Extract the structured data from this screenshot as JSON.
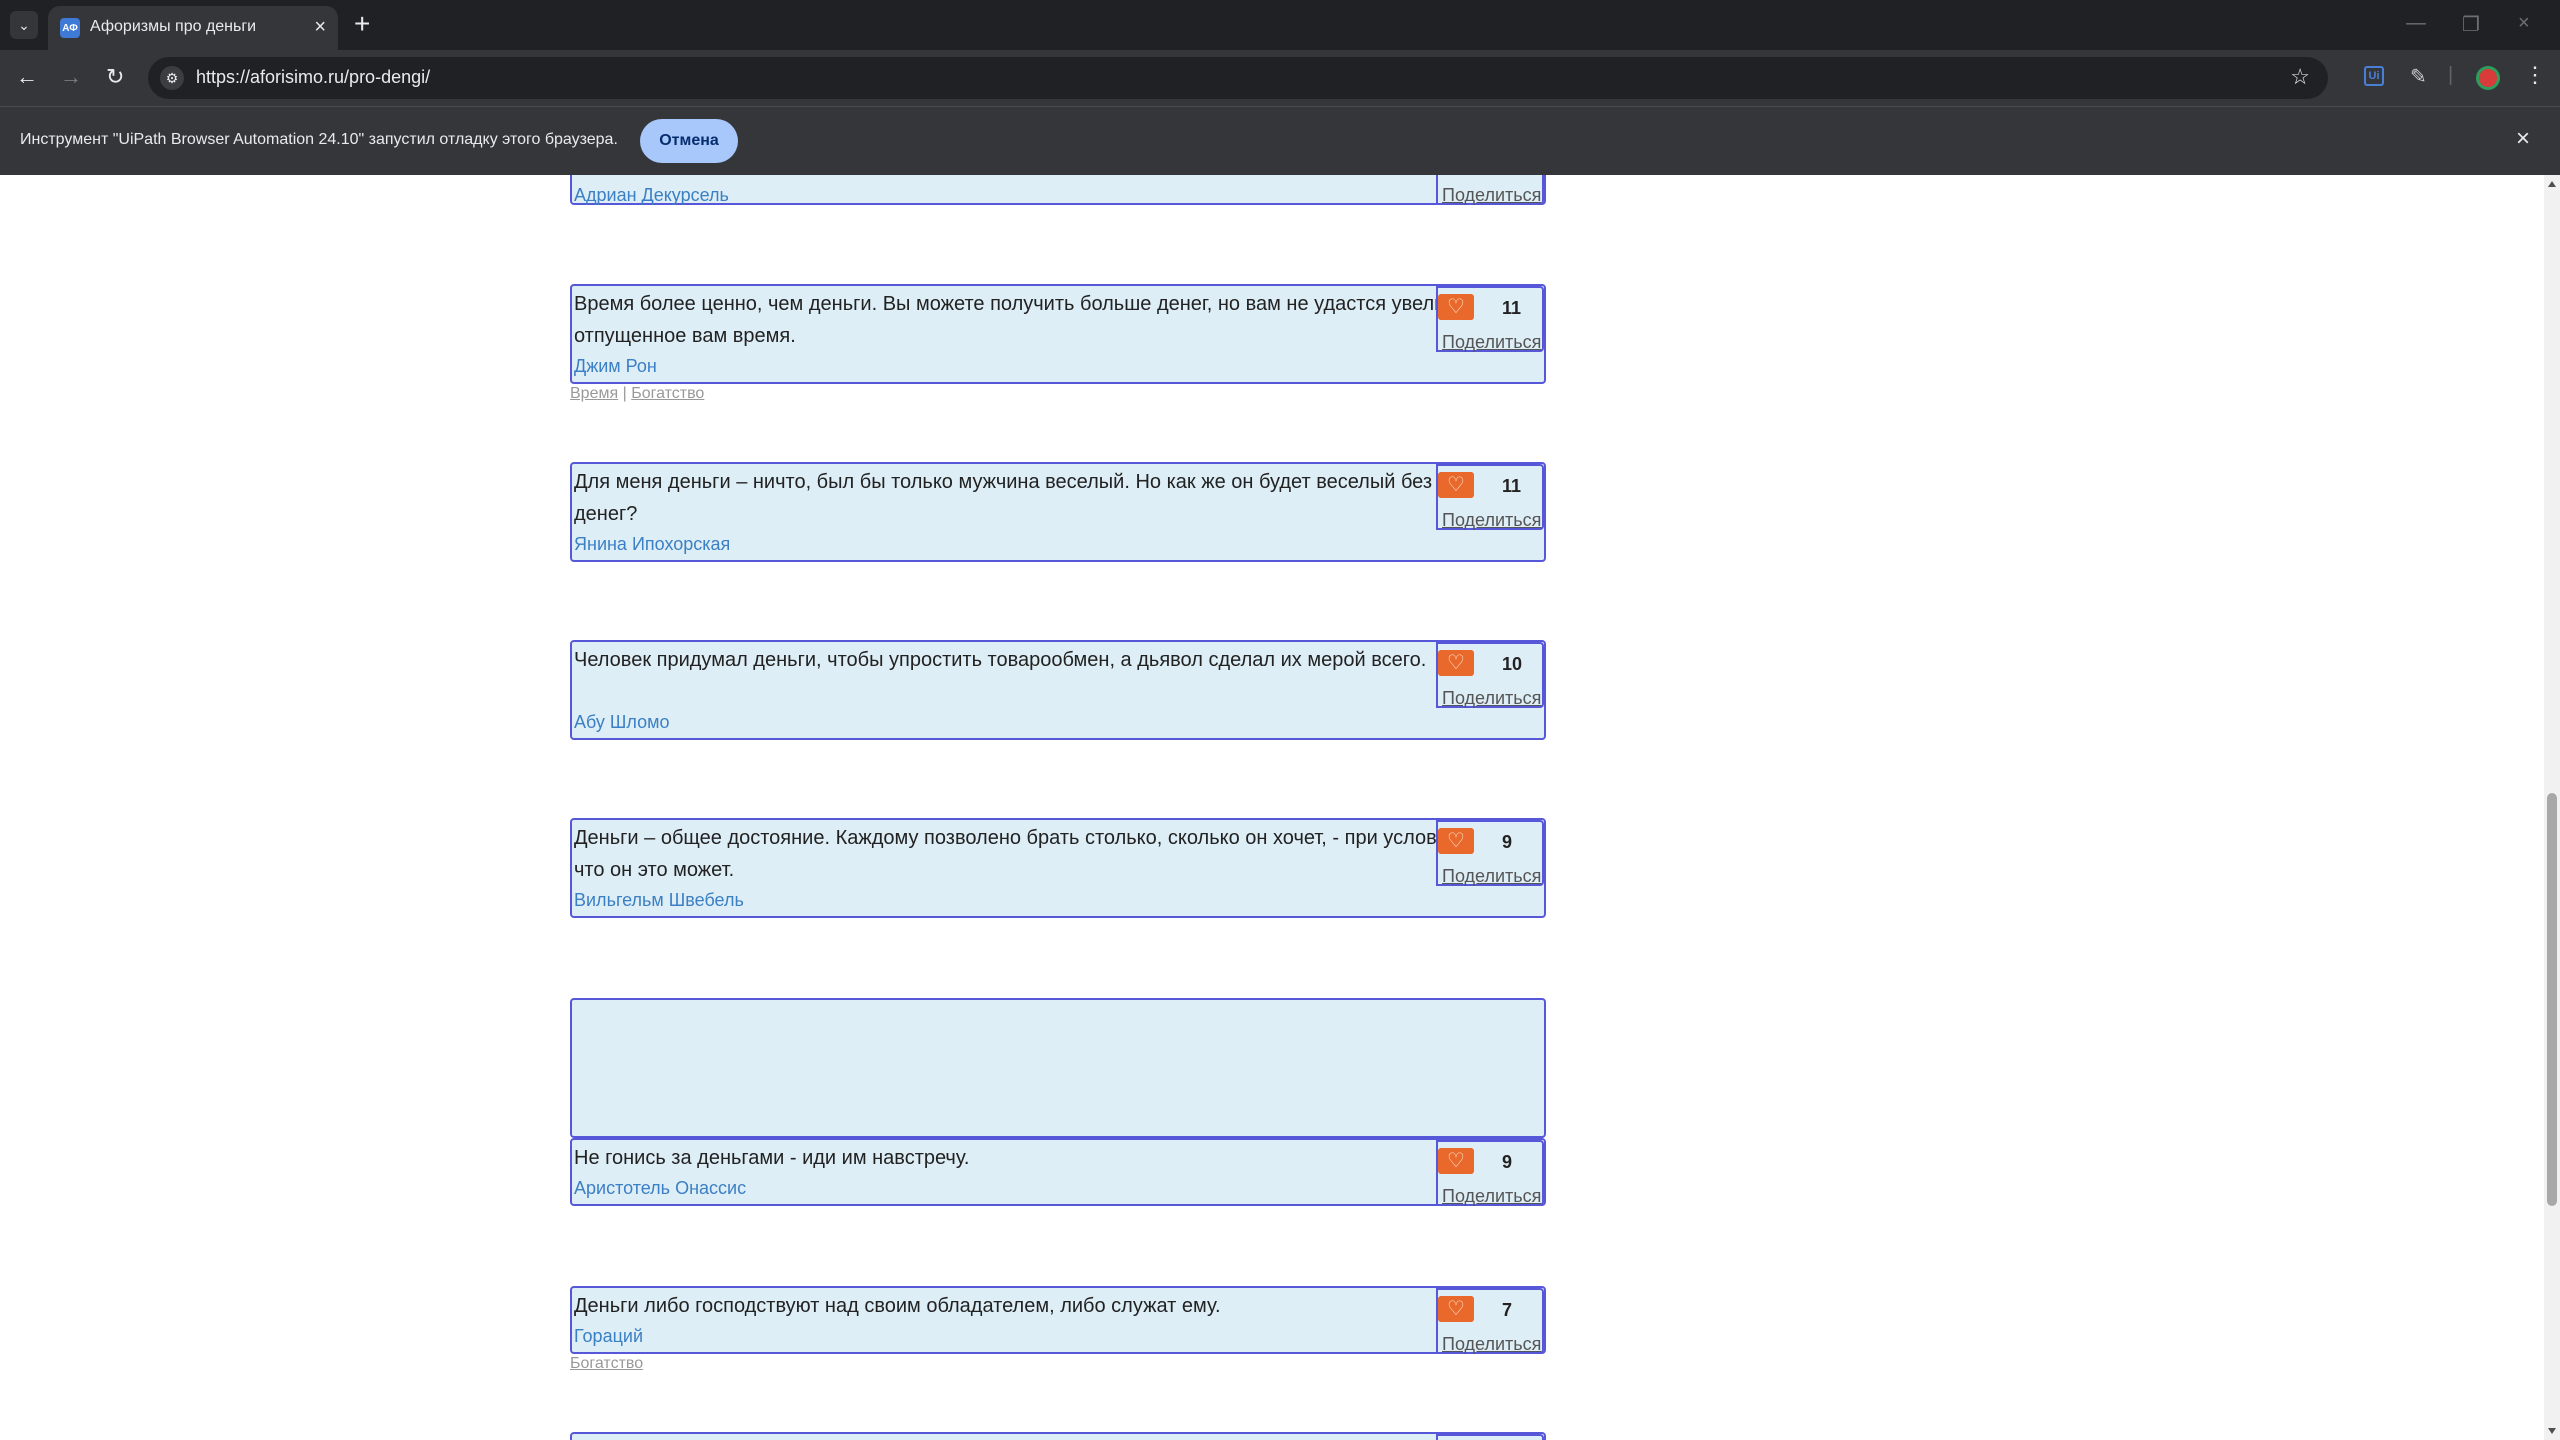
{
  "browser": {
    "tab_title": "Афоризмы про деньги",
    "favicon_text": "АФ",
    "url": "https://aforisimo.ru/pro-dengi/",
    "infobar_text": "Инструмент \"UiPath Browser Automation 24.10\" запустил отладку этого браузера.",
    "cancel_label": "Отмена",
    "accent_color": "#a8c7fa"
  },
  "page": {
    "share_label": "Поделиться",
    "tag_separator": "|",
    "quotes": [
      {
        "text": "",
        "author": "Адриан Декурсель",
        "likes": ""
      },
      {
        "text": "Время более ценно, чем деньги. Вы можете получить больше денег, но вам не удастся увеличить отпущенное вам время.",
        "author": "Джим Рон",
        "likes": "11",
        "tags": [
          "Время",
          "Богатство"
        ]
      },
      {
        "text": "Для меня деньги – ничто, был бы только мужчина веселый. Но как же он будет веселый без денег?",
        "author": "Янина Ипохорская",
        "likes": "11"
      },
      {
        "text": "Человек придумал деньги, чтобы упростить товарообмен, а дьявол сделал их мерой всего.",
        "author": "Абу Шломо",
        "likes": "10"
      },
      {
        "text": "Деньги – общее достояние. Каждому позволено брать столько, сколько он хочет, - при условии, что он это может.",
        "author": "Вильгельм Швебель",
        "likes": "9"
      },
      {
        "text": "Не гонись за деньгами - иди им навстречу.",
        "author": "Аристотель Онассис",
        "likes": "9"
      },
      {
        "text": "Деньги либо господствуют над своим обладателем, либо служат ему.",
        "author": "Гораций",
        "likes": "7",
        "tags": [
          "Богатство"
        ]
      }
    ]
  },
  "colors": {
    "card_bg": "#deeef6",
    "card_border": "#5758d9",
    "author_link": "#3b7fc4",
    "heart_button": "#e8692b"
  }
}
